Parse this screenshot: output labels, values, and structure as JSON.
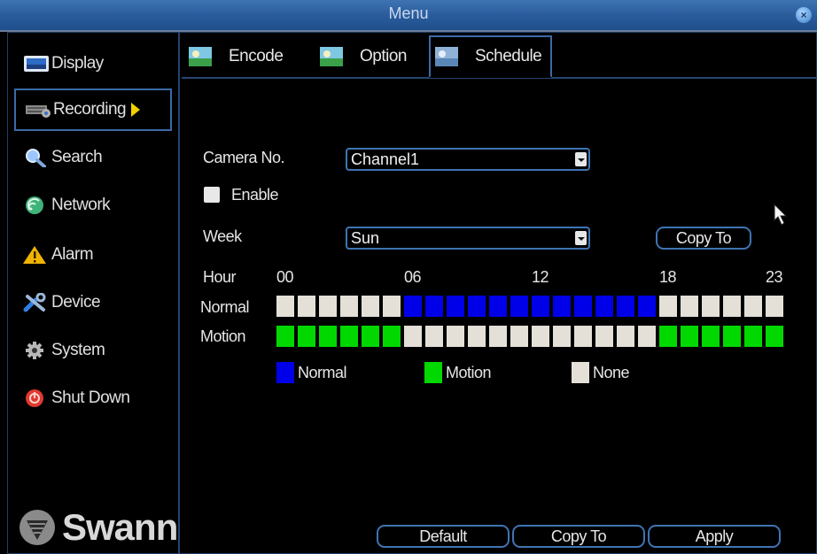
{
  "window": {
    "title": "Menu",
    "close_icon": "close-icon"
  },
  "sidebar": {
    "items": [
      {
        "label": "Display",
        "icon": "display-icon"
      },
      {
        "label": "Recording",
        "icon": "recording-icon",
        "active": true
      },
      {
        "label": "Search",
        "icon": "search-icon"
      },
      {
        "label": "Network",
        "icon": "network-icon"
      },
      {
        "label": "Alarm",
        "icon": "alarm-icon"
      },
      {
        "label": "Device",
        "icon": "device-icon"
      },
      {
        "label": "System",
        "icon": "system-icon"
      },
      {
        "label": "Shut Down",
        "icon": "shutdown-icon"
      }
    ],
    "logo_text": "Swann"
  },
  "tabs": [
    {
      "label": "Encode",
      "icon": "encode-icon"
    },
    {
      "label": "Option",
      "icon": "option-icon"
    },
    {
      "label": "Schedule",
      "icon": "schedule-icon",
      "active": true
    }
  ],
  "form": {
    "camera_label": "Camera No.",
    "camera_value": "Channel1",
    "enable_label": "Enable",
    "enable_checked": false,
    "week_label": "Week",
    "week_value": "Sun",
    "copy_to_label": "Copy To"
  },
  "schedule": {
    "hour_label": "Hour",
    "hour_ticks": [
      "00",
      "06",
      "12",
      "18",
      "23"
    ],
    "rows": [
      {
        "label": "Normal",
        "cells": [
          "none",
          "none",
          "none",
          "none",
          "none",
          "none",
          "normal",
          "normal",
          "normal",
          "normal",
          "normal",
          "normal",
          "normal",
          "normal",
          "normal",
          "normal",
          "normal",
          "normal",
          "none",
          "none",
          "none",
          "none",
          "none",
          "none"
        ]
      },
      {
        "label": "Motion",
        "cells": [
          "motion",
          "motion",
          "motion",
          "motion",
          "motion",
          "motion",
          "none",
          "none",
          "none",
          "none",
          "none",
          "none",
          "none",
          "none",
          "none",
          "none",
          "none",
          "none",
          "motion",
          "motion",
          "motion",
          "motion",
          "motion",
          "motion"
        ]
      }
    ],
    "colors": {
      "normal": "#0000e8",
      "motion": "#00d800",
      "none": "#e4e0d8"
    },
    "legend": [
      {
        "key": "normal",
        "label": "Normal"
      },
      {
        "key": "motion",
        "label": "Motion"
      },
      {
        "key": "none",
        "label": "None"
      }
    ]
  },
  "footer_buttons": {
    "default": "Default",
    "copy_to": "Copy To",
    "apply": "Apply"
  }
}
